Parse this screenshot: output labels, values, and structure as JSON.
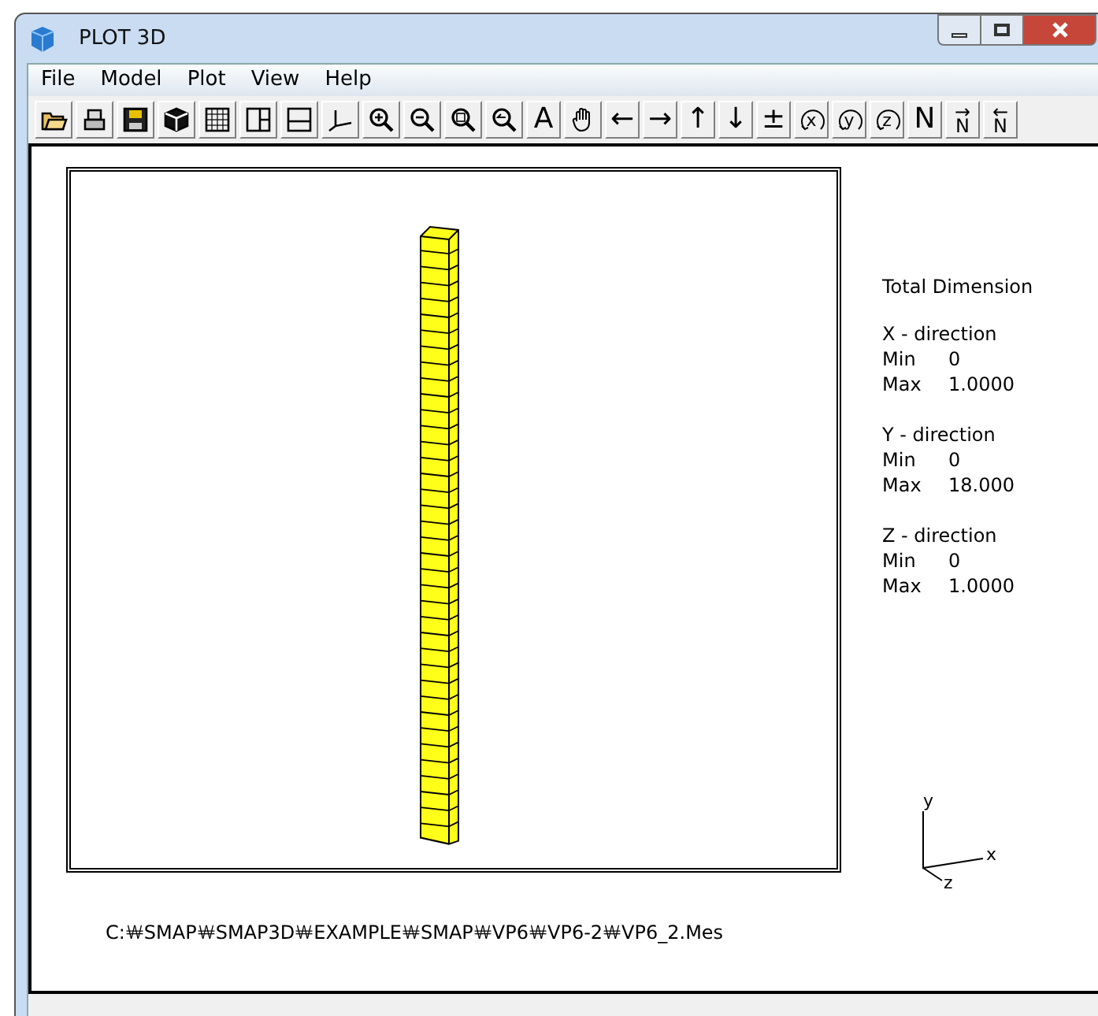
{
  "window": {
    "title": "PLOT 3D"
  },
  "menu": [
    "File",
    "Model",
    "Plot",
    "View",
    "Help"
  ],
  "toolbar": [
    {
      "kind": "open"
    },
    {
      "kind": "print"
    },
    {
      "kind": "save"
    },
    {
      "kind": "cube"
    },
    {
      "kind": "grid"
    },
    {
      "kind": "split-v"
    },
    {
      "kind": "split-h"
    },
    {
      "kind": "axes"
    },
    {
      "kind": "zoom-in"
    },
    {
      "kind": "zoom-out"
    },
    {
      "kind": "zoom-fit"
    },
    {
      "kind": "zoom-back"
    },
    {
      "kind": "glyph",
      "label": "A"
    },
    {
      "kind": "hand"
    },
    {
      "kind": "glyph",
      "label": "←"
    },
    {
      "kind": "glyph",
      "label": "→"
    },
    {
      "kind": "glyph",
      "label": "↑"
    },
    {
      "kind": "glyph",
      "label": "↓"
    },
    {
      "kind": "glyph",
      "label": "±"
    },
    {
      "kind": "rotate",
      "label": "x"
    },
    {
      "kind": "rotate",
      "label": "y"
    },
    {
      "kind": "rotate",
      "label": "z"
    },
    {
      "kind": "glyph",
      "label": "N"
    },
    {
      "kind": "n-arrow",
      "label": "N",
      "arrow": "→"
    },
    {
      "kind": "n-arrow",
      "label": "N",
      "arrow": "←"
    }
  ],
  "info": {
    "title": "Total Dimension",
    "sections": [
      {
        "heading": "X - direction",
        "min_label": "Min",
        "min_value": "0",
        "max_label": "Max",
        "max_value": "1.0000"
      },
      {
        "heading": "Y - direction",
        "min_label": "Min",
        "min_value": "0",
        "max_label": "Max",
        "max_value": "18.000"
      },
      {
        "heading": "Z - direction",
        "min_label": "Min",
        "min_value": "0",
        "max_label": "Max",
        "max_value": "1.0000"
      }
    ]
  },
  "axes": {
    "x": "x",
    "y": "y",
    "z": "z"
  },
  "status_path": "C:￦SMAP￦SMAP3D￦EXAMPLE￦SMAP￦VP6￦VP6-2￦VP6_2.Mes"
}
